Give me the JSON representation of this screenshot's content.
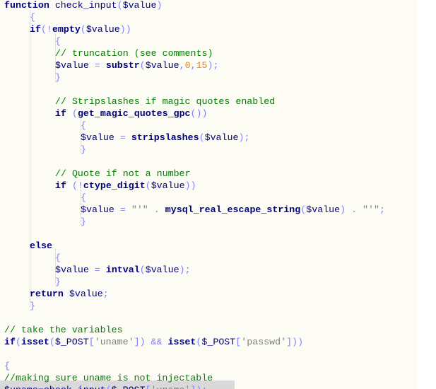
{
  "editor": {
    "lines": [
      "function check_input($value)",
      "{",
      "if(!empty($value))",
      "{",
      "// truncation (see comments)",
      "$value = substr($value,0,15);",
      "}",
      "",
      "// Stripslashes if magic quotes enabled",
      "if (get_magic_quotes_gpc())",
      "{",
      "$value = stripslashes($value);",
      "}",
      "",
      "// Quote if not a number",
      "if (!ctype_digit($value))",
      "{",
      "$value = \"'\" . mysql_real_escape_string($value) . \"'\";",
      "}",
      "",
      "else",
      "{",
      "$value = intval($value);",
      "}",
      "return $value;",
      "}",
      "",
      "// take the variables",
      "if(isset($_POST['uname']) && isset($_POST['passwd']))",
      "",
      "{",
      "//making sure uname is not injectable",
      "$uname=check_input($_POST['uname']);"
    ]
  },
  "colors": {
    "background": "#fcfcf4",
    "keyword": "#000080",
    "comment": "#008000",
    "number": "#ff8000",
    "string": "#808080",
    "operator": "#8080ff",
    "current_line": "#d9d9d9"
  }
}
